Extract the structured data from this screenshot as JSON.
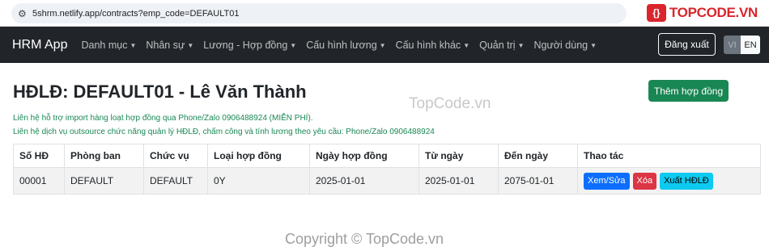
{
  "browser": {
    "url": "5shrm.netlify.app/contracts?emp_code=DEFAULT01",
    "tune_icon": "tune-icon"
  },
  "watermark": {
    "logo_text": "TOPCODE.VN",
    "mid_text": "TopCode.vn",
    "bottom_text": "Copyright © TopCode.vn"
  },
  "navbar": {
    "brand": "HRM App",
    "items": [
      {
        "label": "Danh mục"
      },
      {
        "label": "Nhân sự"
      },
      {
        "label": "Lương - Hợp đồng"
      },
      {
        "label": "Cấu hình lương"
      },
      {
        "label": "Cấu hình khác"
      },
      {
        "label": "Quản trị"
      },
      {
        "label": "Người dùng"
      }
    ],
    "logout_label": "Đăng xuất",
    "lang_vi": "VI",
    "lang_en": "EN"
  },
  "page": {
    "title": "HĐLĐ: DEFAULT01 - Lê Văn Thành",
    "add_button": "Thêm hợp đồng",
    "contact_1": "Liên hệ hỗ trợ import hàng loạt hợp đồng qua Phone/Zalo 0906488924 (MIỄN PHÍ).",
    "contact_2": "Liên hệ dịch vụ outsource chức năng quản lý HĐLĐ, chấm công và tính lương theo yêu cầu: Phone/Zalo 0906488924"
  },
  "table": {
    "headers": [
      "Số HĐ",
      "Phòng ban",
      "Chức vụ",
      "Loại hợp đồng",
      "Ngày hợp đồng",
      "Từ ngày",
      "Đến ngày",
      "Thao tác"
    ],
    "rows": [
      {
        "so_hd": "00001",
        "phong_ban": "DEFAULT",
        "chuc_vu": "DEFAULT",
        "loai_hd": "0Y",
        "ngay_hd": "2025-01-01",
        "tu_ngay": "2025-01-01",
        "den_ngay": "2075-01-01"
      }
    ],
    "actions": {
      "edit": "Xem/Sửa",
      "delete": "Xóa",
      "export": "Xuất HĐLĐ"
    }
  },
  "colors": {
    "navbar_bg": "#212529",
    "success": "#198754",
    "primary": "#0d6efd",
    "danger": "#dc3545",
    "info": "#0dcaf0",
    "logo_red": "#d9252b"
  }
}
